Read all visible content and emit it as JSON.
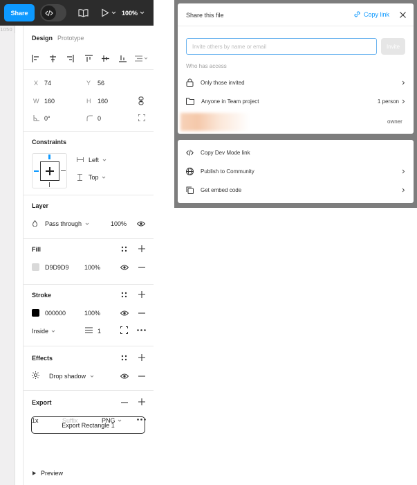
{
  "toolbar": {
    "share_label": "Share",
    "zoom_label": "100%"
  },
  "canvas": {
    "ruler_label": "1050"
  },
  "panel": {
    "tabs": {
      "design": "Design",
      "prototype": "Prototype"
    },
    "position": {
      "x_label": "X",
      "x_value": "74",
      "y_label": "Y",
      "y_value": "56",
      "w_label": "W",
      "w_value": "160",
      "h_label": "H",
      "h_value": "160",
      "rotation_value": "0°",
      "radius_value": "0"
    },
    "constraints": {
      "title": "Constraints",
      "horizontal": "Left",
      "vertical": "Top"
    },
    "layer": {
      "title": "Layer",
      "blend_mode": "Pass through",
      "opacity": "100%"
    },
    "fill": {
      "title": "Fill",
      "color_hex": "D9D9D9",
      "swatch_color": "#d9d9d9",
      "opacity": "100%"
    },
    "stroke": {
      "title": "Stroke",
      "color_hex": "000000",
      "swatch_color": "#000000",
      "opacity": "100%",
      "position": "Inside",
      "weight": "1"
    },
    "effects": {
      "title": "Effects",
      "effect_name": "Drop shadow"
    },
    "export": {
      "title": "Export",
      "scale": "1x",
      "suffix_placeholder": "Suffix",
      "format": "PNG",
      "button_label": "Export Rectangle 1",
      "preview_label": "Preview"
    }
  },
  "share_dialog": {
    "title": "Share this file",
    "copy_link_label": "Copy link",
    "invite_placeholder": "Invite others by name or email",
    "invite_button": "Invite",
    "access_heading": "Who has access",
    "access_rows": [
      {
        "label": "Only those invited",
        "value": ""
      },
      {
        "label": "Anyone in Team project",
        "value": "1 person"
      }
    ],
    "owner_role": "owner",
    "accent_color": "#0d99ff"
  },
  "share_menu": {
    "items": [
      {
        "label": "Copy Dev Mode link"
      },
      {
        "label": "Publish to Community"
      },
      {
        "label": "Get embed code"
      }
    ]
  }
}
